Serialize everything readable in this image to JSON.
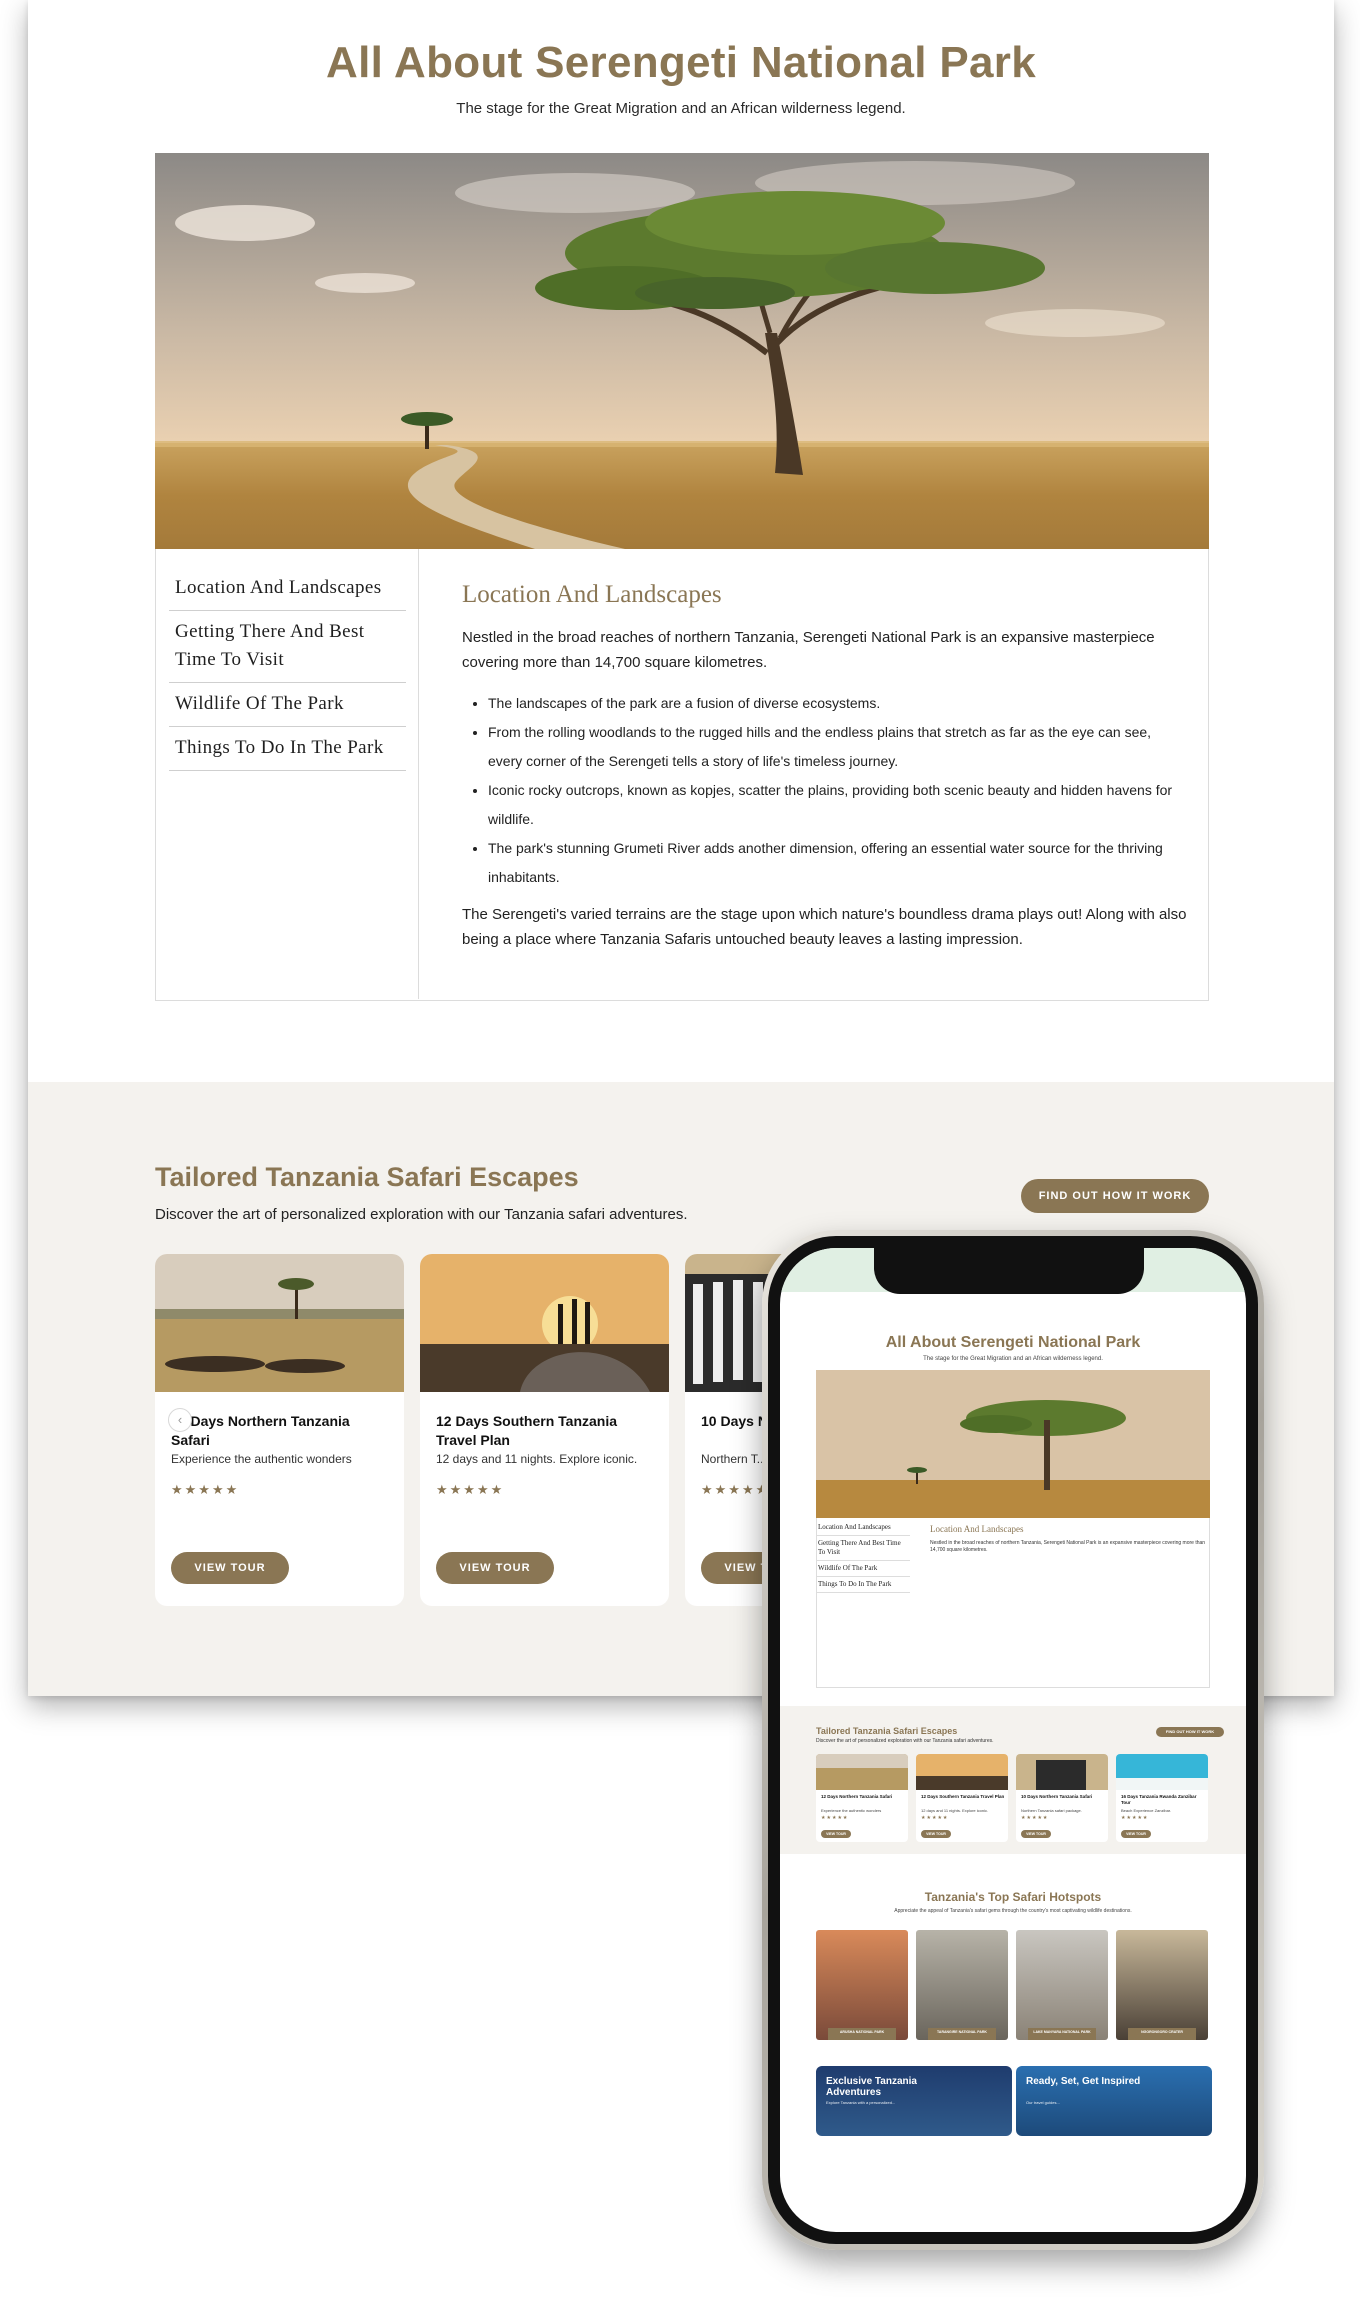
{
  "page": {
    "title": "All About Serengeti National Park",
    "subtitle": "The stage for the Great Migration and an African wilderness legend."
  },
  "toc": {
    "items": [
      {
        "label": "Location And Landscapes"
      },
      {
        "label": "Getting There And Best Time To Visit"
      },
      {
        "label": "Wildlife Of The Park"
      },
      {
        "label": "Things To Do In The Park"
      }
    ]
  },
  "article": {
    "heading": "Location And Landscapes",
    "intro": "Nestled in the broad reaches of northern Tanzania, Serengeti National Park is an expansive masterpiece covering more than 14,700 square kilometres.",
    "bullets": [
      "The landscapes of the park are a fusion of diverse ecosystems.",
      "From the rolling woodlands to the rugged hills and the endless plains that stretch as far as the eye can see, every corner of the Serengeti tells a story of life's timeless journey.",
      "Iconic rocky outcrops, known as kopjes, scatter the plains, providing both scenic beauty and hidden havens for wildlife.",
      "The park's stunning Grumeti River adds another dimension, offering an essential water source for the thriving inhabitants."
    ],
    "outro": "The Serengeti's varied terrains are the stage upon which nature's boundless drama plays out! Along with also being a place where Tanzania Safaris untouched beauty leaves a lasting impression."
  },
  "escapes": {
    "title": "Tailored Tanzania Safari Escapes",
    "subtitle": "Discover the art of personalized exploration with our Tanzania safari adventures.",
    "cta": "FIND OUT HOW IT WORK",
    "prev_icon": "‹",
    "stars": "★★★★★",
    "view_label": "VIEW TOUR",
    "cards": [
      {
        "title": "12 Days Northern Tanzania Safari",
        "desc": "Experience the authentic wonders"
      },
      {
        "title": "12 Days Southern Tanzania Travel Plan",
        "desc": "12 days and 11 nights. Explore iconic."
      },
      {
        "title": "10 Days N... Safari",
        "desc": "Northern T..."
      }
    ]
  },
  "mobile": {
    "title": "All About Serengeti National Park",
    "subtitle": "The stage for the Great Migration and an African wilderness legend.",
    "toc": [
      "Location And Landscapes",
      "Getting There And Best Time To Visit",
      "Wildlife Of The Park",
      "Things To Do In The Park"
    ],
    "heading": "Location And Landscapes",
    "paragraph": "Nestled in the broad reaches of northern Tanzania, Serengeti National Park is an expansive masterpiece covering more than 14,700 square kilometres.",
    "escapes_title": "Tailored Tanzania Safari Escapes",
    "escapes_sub": "Discover the art of personalized exploration with our Tanzania safari adventures.",
    "escapes_cta": "FIND OUT HOW IT WORK",
    "cards": [
      {
        "title": "12 Days Northern Tanzania Safari",
        "desc": "Experience the authentic wonders"
      },
      {
        "title": "12 Days Southern Tanzania Travel Plan",
        "desc": "12 days and 11 nights. Explore iconic."
      },
      {
        "title": "10 Days Northern Tanzania Safari",
        "desc": "Northern Tanzania safari package."
      },
      {
        "title": "16 Days Tanzania Rwanda Zanzibar Tour",
        "desc": "Beach Experience Zanzibar."
      }
    ],
    "view_label": "VIEW TOUR",
    "stars": "★★★★★",
    "hotspots_title": "Tanzania's Top Safari Hotspots",
    "hotspots_sub": "Appreciate the appeal of Tanzania's safari gems through the country's most captivating wildlife destinations.",
    "hotspots": [
      "ARUSHA NATIONAL PARK",
      "TARANGIRE NATIONAL PARK",
      "LAKE MANYARA NATIONAL PARK",
      "NGORONGORO CRATER"
    ],
    "banners": [
      {
        "title": "Exclusive Tanzania Adventures",
        "sub": "Explore Tanzania with a personalized..."
      },
      {
        "title": "Ready, Set, Get Inspired",
        "sub": "Our travel guides..."
      }
    ]
  },
  "colors": {
    "accent": "#8a7654",
    "section_bg": "#f4f2ee"
  }
}
